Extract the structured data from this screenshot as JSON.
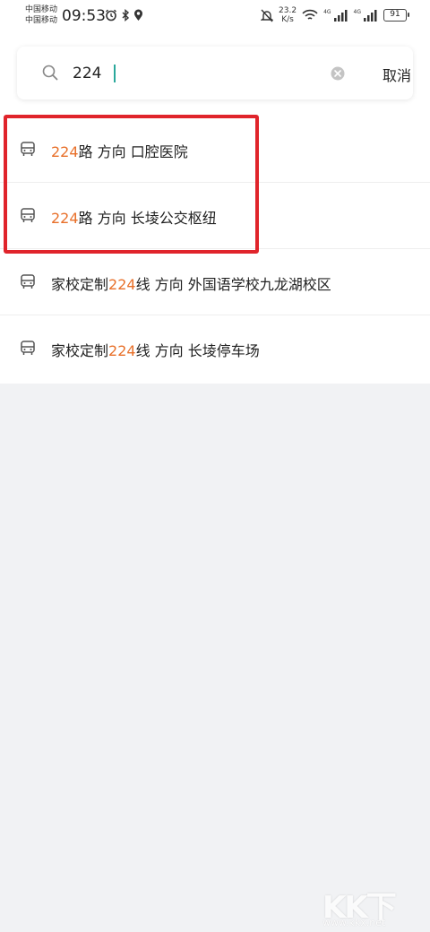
{
  "status_bar": {
    "carrier_1": "中国移动",
    "carrier_2": "中国移动",
    "time": "09:53",
    "net_speed_value": "23.2",
    "net_speed_unit": "K/s",
    "network_tag_1": "4G",
    "network_tag_2": "4G",
    "battery": "91",
    "icons_left": [
      "alarm-icon",
      "bluetooth-icon",
      "location-icon"
    ],
    "icons_right": [
      "mute-bell-icon",
      "wifi-icon",
      "signal-icon",
      "signal-icon"
    ]
  },
  "search": {
    "value": "224",
    "cancel_label": "取消"
  },
  "results": [
    {
      "highlight": "224",
      "prefix": "",
      "suffix": "路 方向 口腔医院",
      "icon": "bus-icon"
    },
    {
      "highlight": "224",
      "prefix": "",
      "suffix": "路 方向 长堎公交枢纽",
      "icon": "bus-icon"
    },
    {
      "highlight": "224",
      "prefix": "家校定制",
      "suffix": "线 方向 外国语学校九龙湖校区",
      "icon": "bus-icon"
    },
    {
      "highlight": "224",
      "prefix": "家校定制",
      "suffix": "线 方向 长堎停车场",
      "icon": "bus-icon"
    }
  ],
  "colors": {
    "highlight_text": "#e8702a",
    "annotation_frame": "#e0242b",
    "caret": "#2aa89b",
    "background": "#f1f2f4"
  },
  "watermark": {
    "logo": "KK下载",
    "url": "www.kkx.net"
  }
}
